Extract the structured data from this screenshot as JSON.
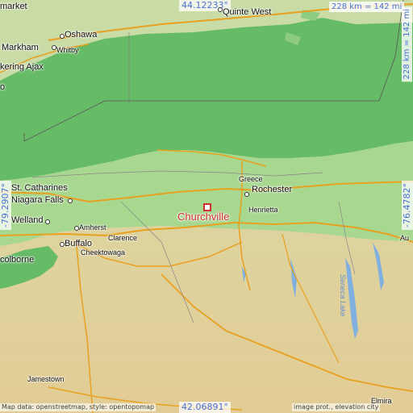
{
  "map": {
    "coords": {
      "top": "44.12233°",
      "bottom": "42.06891°",
      "left": "-79.2907°",
      "right": "-76.4782°"
    },
    "scale": {
      "horizontal": "228 km = 142 mi",
      "vertical": "228 km = 142 mi"
    },
    "highlight": "Churchville",
    "places": {
      "market": "market",
      "quinte_west": "Quinte West",
      "oshawa": "Oshawa",
      "markham": "Markham",
      "whitby": "Whitby",
      "pickering_ajax": "kering Ajax",
      "o": "o",
      "st_catharines": "St. Catharines",
      "niagara_falls": "Niagara Falls",
      "welland": "Welland",
      "amherst": "Amherst",
      "buffalo": "Buffalo",
      "clarence": "Clarence",
      "cheektowaga": "Cheektowaga",
      "colborne": "colborne",
      "greece": "Greece",
      "rochester": "Rochester",
      "henrietta": "Henrietta",
      "auburn": "Au",
      "jamestown": "Jamestown",
      "elmira": "Elmira"
    },
    "water": {
      "seneca_lake": "Seneca Lake"
    },
    "credit": {
      "left": "Map data: openstreetmap, style: opentopomap",
      "right": "image prot., elevation city"
    },
    "colors": {
      "lake": "#66bb66",
      "lowland": "#a8d890",
      "highland": "#e6d4a0",
      "road": "#e8a020",
      "accent": "#4a6fd6",
      "highlight": "#d03030"
    }
  }
}
